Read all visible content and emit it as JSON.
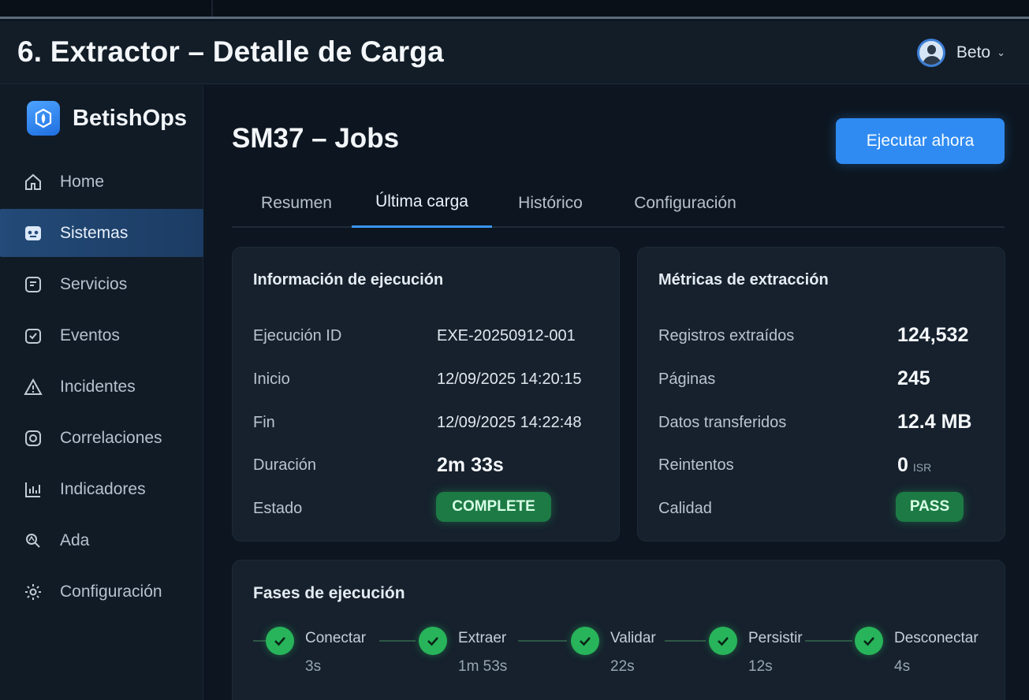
{
  "header": {
    "title": "6. Extractor – Detalle de Carga",
    "user": "Beto"
  },
  "sidebar": {
    "brand": "BetishOps",
    "items": [
      {
        "label": "Home",
        "icon": "home-icon"
      },
      {
        "label": "Sistemas",
        "icon": "systems-icon",
        "active": true
      },
      {
        "label": "Servicios",
        "icon": "services-icon"
      },
      {
        "label": "Eventos",
        "icon": "events-icon"
      },
      {
        "label": "Incidentes",
        "icon": "warning-icon"
      },
      {
        "label": "Correlaciones",
        "icon": "correlations-icon"
      },
      {
        "label": "Indicadores",
        "icon": "chart-icon"
      },
      {
        "label": "Ada",
        "icon": "ada-icon"
      },
      {
        "label": "Configuración",
        "icon": "gear-icon"
      }
    ]
  },
  "main": {
    "title": "SM37 – Jobs",
    "run_button": "Ejecutar ahora",
    "tabs": [
      "Resumen",
      "Última carga",
      "Histórico",
      "Configuración"
    ],
    "active_tab": "Última carga"
  },
  "execution": {
    "title": "Información de ejecución",
    "rows": [
      {
        "label": "Ejecución ID",
        "value": "EXE-20250912-001"
      },
      {
        "label": "Inicio",
        "value": "12/09/2025 14:20:15"
      },
      {
        "label": "Fin",
        "value": "12/09/2025 14:22:48"
      },
      {
        "label": "Duración",
        "value": "2m 33s"
      },
      {
        "label": "Estado",
        "value": "COMPLETE"
      }
    ]
  },
  "metrics": {
    "title": "Métricas de extracción",
    "rows": [
      {
        "label": "Registros extraídos",
        "value": "124,532"
      },
      {
        "label": "Páginas",
        "value": "245"
      },
      {
        "label": "Datos transferidos",
        "value": "12.4 MB"
      },
      {
        "label": "Reintentos",
        "value": "0",
        "hint": "ISR"
      },
      {
        "label": "Calidad",
        "value": "PASS"
      }
    ]
  },
  "phases": {
    "title": "Fases de ejecución",
    "items": [
      {
        "name": "Conectar",
        "duration": "3s"
      },
      {
        "name": "Extraer",
        "duration": "1m 53s"
      },
      {
        "name": "Validar",
        "duration": "22s"
      },
      {
        "name": "Persistir",
        "duration": "12s"
      },
      {
        "name": "Desconectar",
        "duration": "4s"
      }
    ]
  },
  "colors": {
    "accent": "#2f8bf2",
    "success": "#28b45a",
    "background": "#0d1620"
  }
}
